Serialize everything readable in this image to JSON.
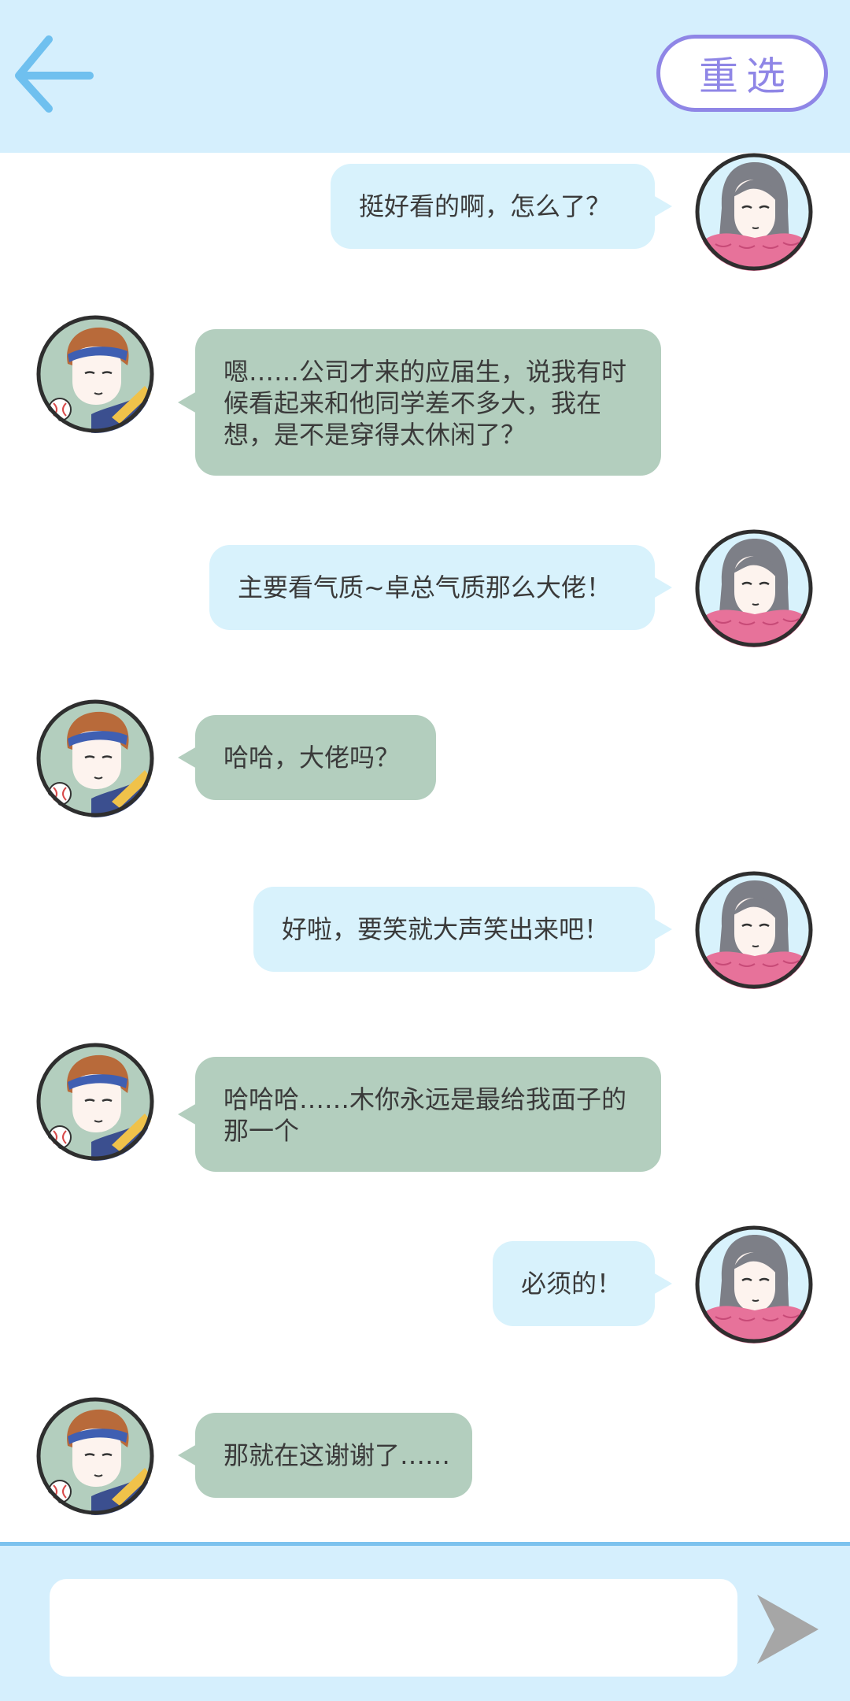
{
  "header": {
    "reselect_label": "重选"
  },
  "messages": [
    {
      "side": "her",
      "text": "挺好看的啊，怎么了？"
    },
    {
      "side": "him",
      "text": "嗯……公司才来的应届生，说我有时候看起来和他同学差不多大，我在想，是不是穿得太休闲了？"
    },
    {
      "side": "her",
      "text": "主要看气质~卓总气质那么大佬！"
    },
    {
      "side": "him",
      "text": "哈哈，大佬吗？"
    },
    {
      "side": "her",
      "text": "好啦，要笑就大声笑出来吧！"
    },
    {
      "side": "him",
      "text": "哈哈哈……木你永远是最给我面子的那一个"
    },
    {
      "side": "her",
      "text": "必须的！"
    },
    {
      "side": "him",
      "text": "那就在这谢谢了……"
    }
  ],
  "composer": {
    "value": "",
    "placeholder": ""
  },
  "colors": {
    "header_bg": "#d5effd",
    "her_bubble": "#d8f2fc",
    "him_bubble": "#b3cebe",
    "back_arrow": "#6fc0ef",
    "reselect_border": "#8f86e6",
    "send_icon": "#a6a6a6"
  },
  "icons": {
    "back": "arrow-left-icon",
    "send": "send-icon"
  }
}
